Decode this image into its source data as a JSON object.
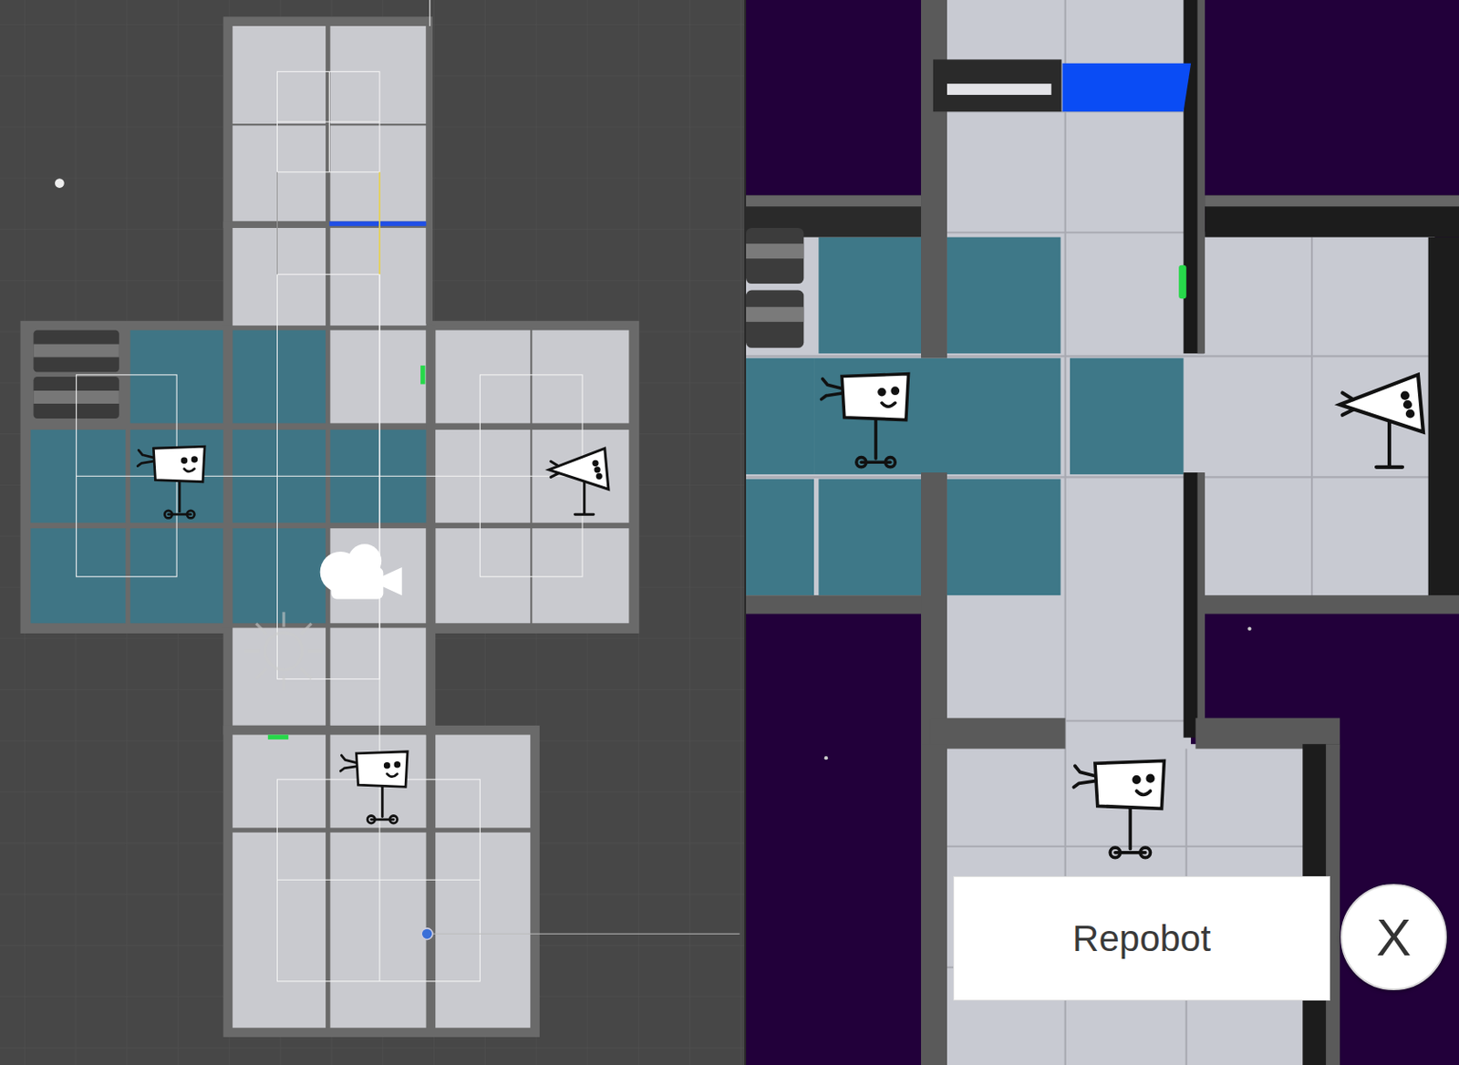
{
  "game_view": {
    "name_label": "Repobot",
    "close_button": "X"
  }
}
